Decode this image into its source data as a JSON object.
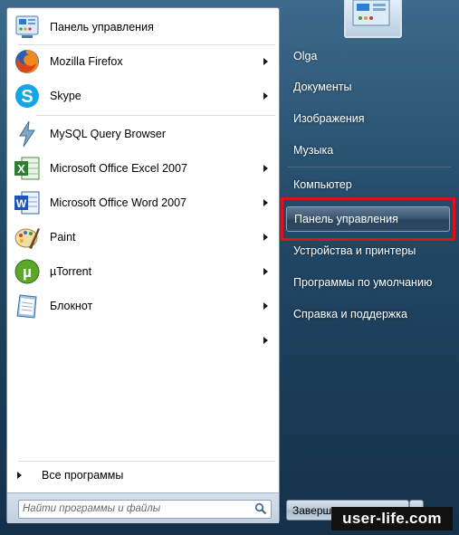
{
  "programs": [
    {
      "label": "Панель управления",
      "icon": "control-panel-icon",
      "arrow": false
    },
    {
      "label": "Mozilla Firefox",
      "icon": "firefox-icon",
      "arrow": true
    },
    {
      "label": "Skype",
      "icon": "skype-icon",
      "arrow": true
    },
    {
      "label": "MySQL Query Browser",
      "icon": "mysql-icon",
      "arrow": false
    },
    {
      "label": "Microsoft Office Excel 2007",
      "icon": "excel-icon",
      "arrow": true
    },
    {
      "label": "Microsoft Office Word 2007",
      "icon": "word-icon",
      "arrow": true
    },
    {
      "label": "Paint",
      "icon": "paint-icon",
      "arrow": true
    },
    {
      "label": "µTorrent",
      "icon": "utorrent-icon",
      "arrow": true
    },
    {
      "label": "Блокнот",
      "icon": "notepad-icon",
      "arrow": true
    }
  ],
  "all_programs_label": "Все программы",
  "search": {
    "placeholder": "Найти программы и файлы"
  },
  "right_items": [
    {
      "label": "Olga"
    },
    {
      "label": "Документы"
    },
    {
      "label": "Изображения"
    },
    {
      "label": "Музыка"
    },
    {
      "label": "Компьютер"
    },
    {
      "label": "Панель управления"
    },
    {
      "label": "Устройства и принтеры"
    },
    {
      "label": "Программы по умолчанию"
    },
    {
      "label": "Справка и поддержка"
    }
  ],
  "shutdown_label": "Заверш",
  "watermark": "user-life.com",
  "colors": {
    "highlight": "#e0101a",
    "panel_bg": "#1f3f5a"
  }
}
